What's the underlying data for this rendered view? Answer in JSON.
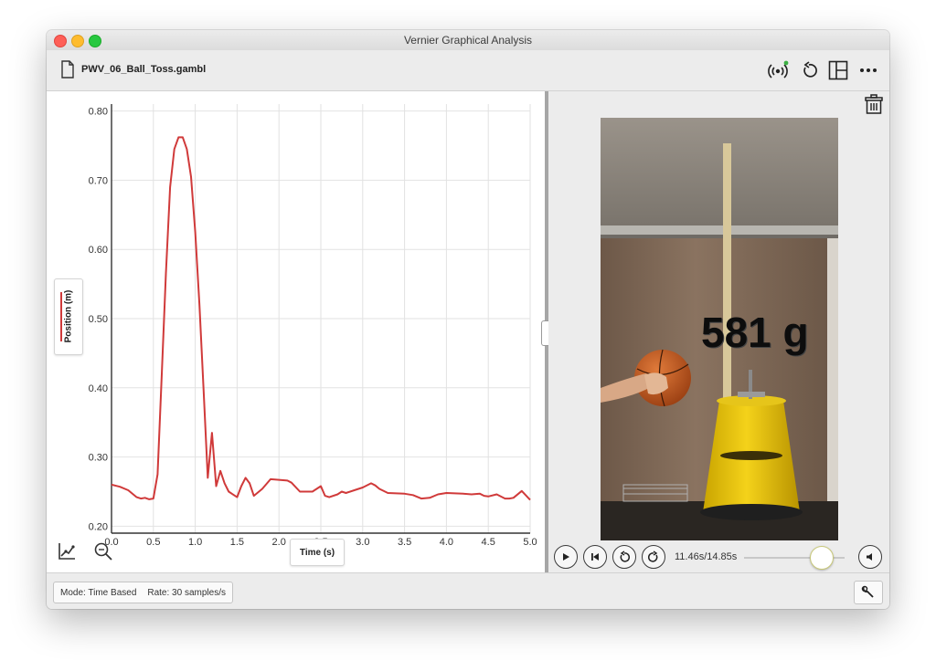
{
  "window": {
    "title": "Vernier Graphical Analysis"
  },
  "toolbar": {
    "file_name": "PWV_06_Ball_Toss.gambl",
    "icons": [
      "sensor-connect-icon",
      "undo-icon",
      "layout-icon",
      "more-icon"
    ],
    "sensor_status_color": "#3cb043"
  },
  "graph": {
    "y_axis_label": "Position (m)",
    "x_axis_label": "Time (s)",
    "series_color": "#d03a3a"
  },
  "chart_data": {
    "type": "line",
    "xlabel": "Time (s)",
    "ylabel": "Position (m)",
    "xlim": [
      0.0,
      5.0
    ],
    "ylim": [
      0.19,
      0.81
    ],
    "x_ticks": [
      "0.0",
      "0.5",
      "1.0",
      "1.5",
      "2.0",
      "2.5",
      "3.0",
      "3.5",
      "4.0",
      "4.5",
      "5.0"
    ],
    "y_ticks": [
      "0.20",
      "0.30",
      "0.40",
      "0.50",
      "0.60",
      "0.70",
      "0.80"
    ],
    "grid": true,
    "series": [
      {
        "name": "Position (m)",
        "x": [
          0.0,
          0.1,
          0.2,
          0.3,
          0.35,
          0.4,
          0.45,
          0.5,
          0.55,
          0.6,
          0.65,
          0.7,
          0.75,
          0.8,
          0.85,
          0.9,
          0.95,
          1.0,
          1.05,
          1.1,
          1.15,
          1.2,
          1.25,
          1.3,
          1.35,
          1.4,
          1.5,
          1.55,
          1.6,
          1.65,
          1.7,
          1.8,
          1.9,
          2.0,
          2.1,
          2.15,
          2.25,
          2.4,
          2.5,
          2.55,
          2.6,
          2.7,
          2.75,
          2.8,
          2.9,
          3.0,
          3.1,
          3.15,
          3.2,
          3.3,
          3.5,
          3.6,
          3.7,
          3.8,
          3.9,
          4.0,
          4.2,
          4.3,
          4.4,
          4.45,
          4.5,
          4.6,
          4.7,
          4.75,
          4.8,
          4.9,
          5.0
        ],
        "y": [
          0.26,
          0.257,
          0.252,
          0.242,
          0.24,
          0.241,
          0.239,
          0.24,
          0.275,
          0.42,
          0.565,
          0.69,
          0.745,
          0.762,
          0.762,
          0.745,
          0.705,
          0.625,
          0.52,
          0.395,
          0.27,
          0.335,
          0.258,
          0.28,
          0.262,
          0.25,
          0.242,
          0.258,
          0.27,
          0.262,
          0.244,
          0.254,
          0.268,
          0.267,
          0.266,
          0.263,
          0.25,
          0.25,
          0.258,
          0.244,
          0.242,
          0.246,
          0.25,
          0.248,
          0.252,
          0.256,
          0.262,
          0.259,
          0.254,
          0.248,
          0.247,
          0.245,
          0.24,
          0.241,
          0.246,
          0.248,
          0.247,
          0.246,
          0.247,
          0.244,
          0.243,
          0.246,
          0.24,
          0.24,
          0.241,
          0.251,
          0.238
        ]
      }
    ]
  },
  "video": {
    "overlay_text": "581 g",
    "time_readout": "11.46s/14.85s",
    "progress_fraction": 0.772
  },
  "status": {
    "mode": "Mode: Time Based",
    "rate": "Rate: 30 samples/s"
  }
}
